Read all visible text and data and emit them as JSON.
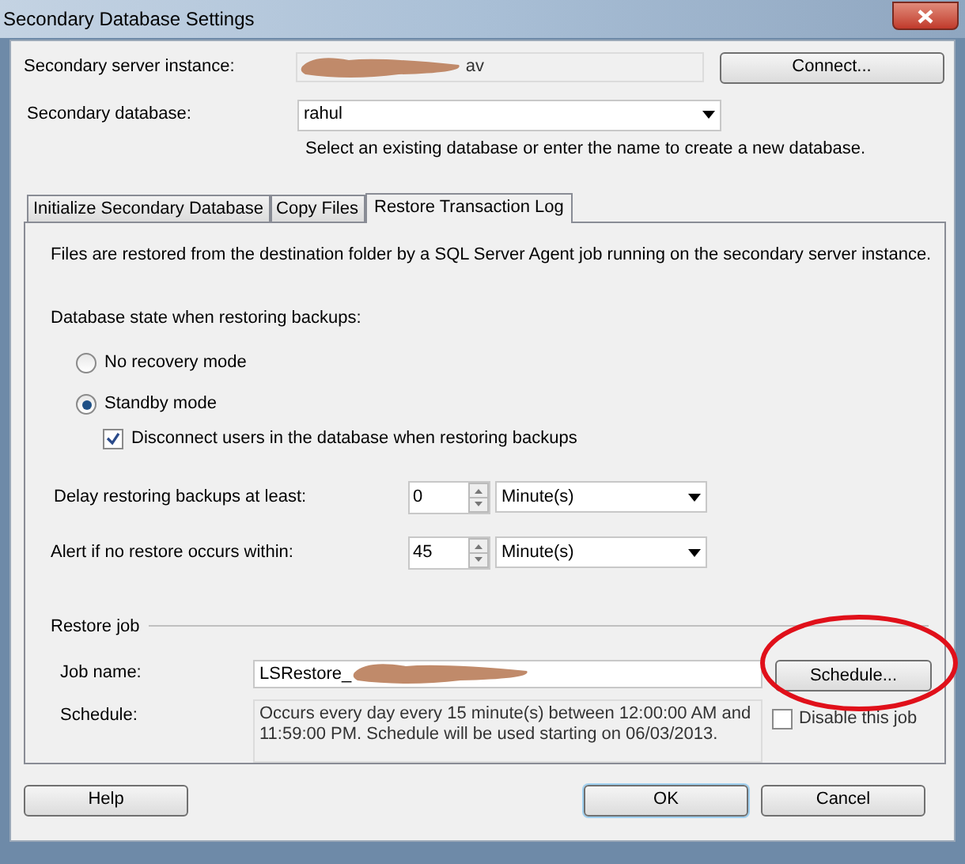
{
  "window": {
    "title": "Secondary Database Settings"
  },
  "server_instance": {
    "label": "Secondary server instance:",
    "value": "av",
    "button": "Connect..."
  },
  "secondary_database": {
    "label": "Secondary database:",
    "value": "rahul",
    "hint": "Select an existing database or enter the name to create a new database."
  },
  "tabs": [
    {
      "label": "Initialize Secondary Database",
      "selected": false
    },
    {
      "label": "Copy Files",
      "selected": false
    },
    {
      "label": "Restore Transaction Log",
      "selected": true
    }
  ],
  "panel": {
    "description": "Files are restored from the destination folder by a SQL Server Agent job running on the secondary server instance.",
    "state_label": "Database state when restoring backups:",
    "modes": [
      {
        "label": "No recovery mode",
        "selected": false
      },
      {
        "label": "Standby mode",
        "selected": true
      }
    ],
    "disconnect_users": {
      "label": "Disconnect users in the database when restoring backups",
      "checked": true
    },
    "timings": [
      {
        "label": "Delay restoring backups at least:",
        "value": "0",
        "unit": "Minute(s)"
      },
      {
        "label": "Alert if no restore occurs within:",
        "value": "45",
        "unit": "Minute(s)"
      }
    ],
    "restore_job": {
      "heading": "Restore job",
      "job_name_label": "Job name:",
      "job_name": "LSRestore_",
      "schedule_label": "Schedule:",
      "schedule_text": "Occurs every day every 15 minute(s) between 12:00:00 AM and 11:59:00 PM. Schedule will be used starting on 06/03/2013.",
      "schedule_button": "Schedule...",
      "disable_job": {
        "label": "Disable this job",
        "checked": false
      }
    }
  },
  "buttons": [
    {
      "label": "Help",
      "default": false
    },
    {
      "label": "OK",
      "default": true
    },
    {
      "label": "Cancel",
      "default": false
    }
  ]
}
